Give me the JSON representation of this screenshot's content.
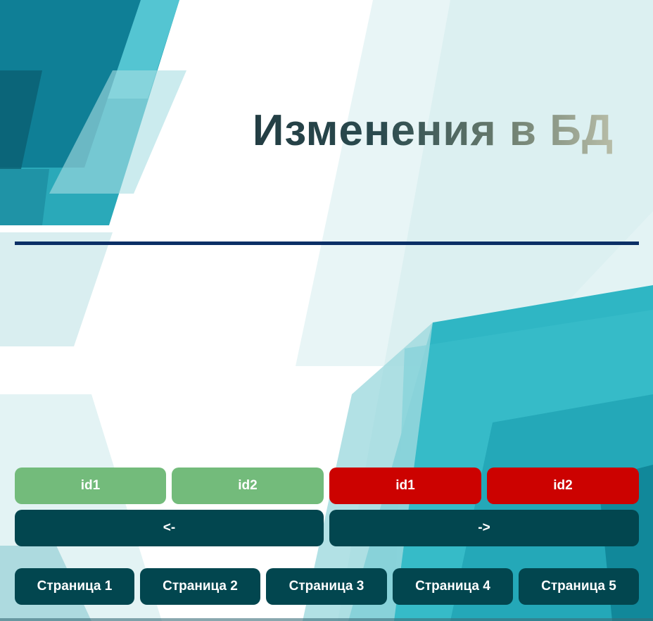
{
  "header": {
    "title": "Изменения в БД"
  },
  "id_buttons": {
    "green_id1": "id1",
    "green_id2": "id2",
    "red_id1": "id1",
    "red_id2": "id2"
  },
  "nav_buttons": {
    "prev": "<-",
    "next": "->"
  },
  "pages": [
    {
      "label": "Страница 1"
    },
    {
      "label": "Страница 2"
    },
    {
      "label": "Страница 3"
    },
    {
      "label": "Страница 4"
    },
    {
      "label": "Страница 5"
    }
  ],
  "colors": {
    "green_button": "#73bb7b",
    "red_button": "#cc0200",
    "dark_button": "#02464f",
    "divider": "#0b2f66",
    "teal_accent": "#2cb5c4"
  }
}
